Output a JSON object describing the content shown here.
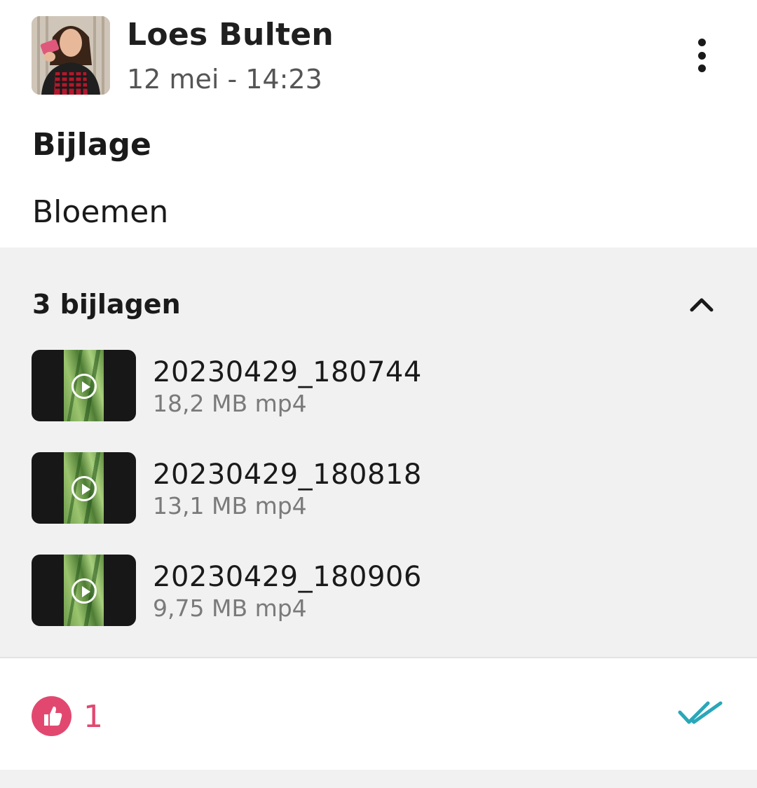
{
  "post": {
    "author": "Loes Bulten",
    "timestamp": "12 mei - 14:23",
    "title": "Bijlage",
    "body": "Bloemen"
  },
  "attachments": {
    "count_label": "3 bijlagen",
    "items": [
      {
        "name": "20230429_180744",
        "meta": "18,2 MB mp4"
      },
      {
        "name": "20230429_180818",
        "meta": "13,1 MB mp4"
      },
      {
        "name": "20230429_180906",
        "meta": "9,75 MB mp4"
      }
    ]
  },
  "footer": {
    "like_count": "1"
  },
  "icons": {
    "more": "more-vertical-icon",
    "collapse": "chevron-up-icon",
    "like": "thumbs-up-icon",
    "read": "double-check-icon",
    "play": "play-icon"
  },
  "colors": {
    "like": "#e2486f",
    "read_check": "#2aa7b8",
    "panel_background": "#f1f1f1"
  }
}
